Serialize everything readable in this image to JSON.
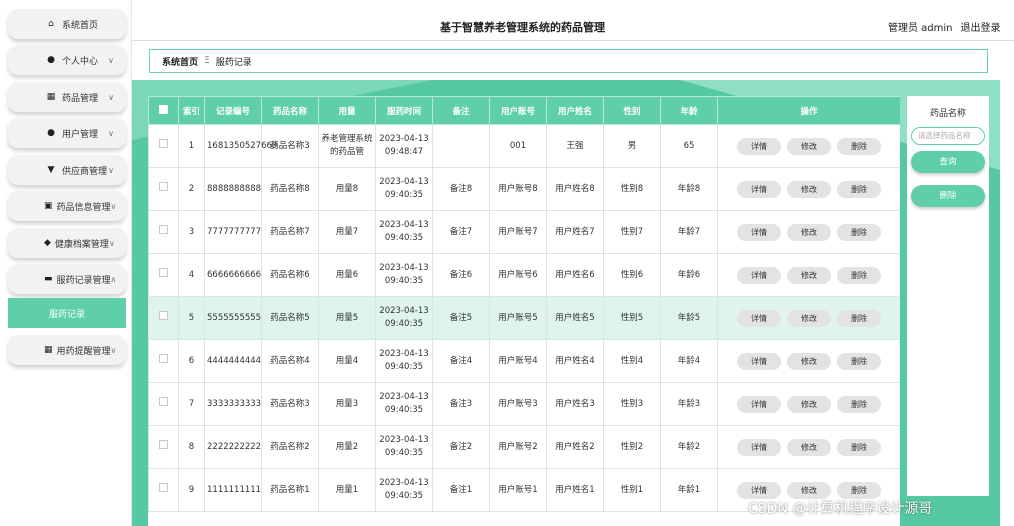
{
  "header": {
    "title": "基于智慧养老管理系统的药品管理",
    "user": "管理员 admin",
    "logout": "退出登录"
  },
  "sidebar": {
    "items": [
      {
        "label": "系统首页",
        "icon": "home-icon"
      },
      {
        "label": "个人中心",
        "icon": "user-icon"
      },
      {
        "label": "药品管理",
        "icon": "grid-icon"
      },
      {
        "label": "用户管理",
        "icon": "user-icon"
      },
      {
        "label": "供应商管理",
        "icon": "funnel-icon"
      },
      {
        "label": "药品信息管理",
        "icon": "chart-icon"
      },
      {
        "label": "健康档案管理",
        "icon": "pin-icon"
      },
      {
        "label": "服药记录管理",
        "icon": "monitor-icon"
      },
      {
        "label": "用药提醒管理",
        "icon": "grid-icon"
      }
    ],
    "sub_item": "服药记录"
  },
  "breadcrumb": {
    "home": "系统首页",
    "sep": "Ξ",
    "current": "服药记录"
  },
  "table": {
    "headers": [
      "索引",
      "记录编号",
      "药品名称",
      "用量",
      "服药时间",
      "备注",
      "用户账号",
      "用户姓名",
      "性别",
      "年龄",
      "操作"
    ],
    "actions": {
      "detail": "详情",
      "edit": "修改",
      "delete": "删除"
    },
    "rows": [
      {
        "index": "1",
        "code": "1681350527669",
        "drug": "药品名称3",
        "dose": "养老管理系统的药品管",
        "time": "2023-04-13 09:48:47",
        "note": "",
        "account": "001",
        "name": "王强",
        "gender": "男",
        "age": "65"
      },
      {
        "index": "2",
        "code": "8888888888",
        "drug": "药品名称8",
        "dose": "用量8",
        "time": "2023-04-13 09:40:35",
        "note": "备注8",
        "account": "用户账号8",
        "name": "用户姓名8",
        "gender": "性别8",
        "age": "年龄8"
      },
      {
        "index": "3",
        "code": "7777777777",
        "drug": "药品名称7",
        "dose": "用量7",
        "time": "2023-04-13 09:40:35",
        "note": "备注7",
        "account": "用户账号7",
        "name": "用户姓名7",
        "gender": "性别7",
        "age": "年龄7"
      },
      {
        "index": "4",
        "code": "6666666666",
        "drug": "药品名称6",
        "dose": "用量6",
        "time": "2023-04-13 09:40:35",
        "note": "备注6",
        "account": "用户账号6",
        "name": "用户姓名6",
        "gender": "性别6",
        "age": "年龄6"
      },
      {
        "index": "5",
        "code": "5555555555",
        "drug": "药品名称5",
        "dose": "用量5",
        "time": "2023-04-13 09:40:35",
        "note": "备注5",
        "account": "用户账号5",
        "name": "用户姓名5",
        "gender": "性别5",
        "age": "年龄5"
      },
      {
        "index": "6",
        "code": "4444444444",
        "drug": "药品名称4",
        "dose": "用量4",
        "time": "2023-04-13 09:40:35",
        "note": "备注4",
        "account": "用户账号4",
        "name": "用户姓名4",
        "gender": "性别4",
        "age": "年龄4"
      },
      {
        "index": "7",
        "code": "3333333333",
        "drug": "药品名称3",
        "dose": "用量3",
        "time": "2023-04-13 09:40:35",
        "note": "备注3",
        "account": "用户账号3",
        "name": "用户姓名3",
        "gender": "性别3",
        "age": "年龄3"
      },
      {
        "index": "8",
        "code": "2222222222",
        "drug": "药品名称2",
        "dose": "用量2",
        "time": "2023-04-13 09:40:35",
        "note": "备注2",
        "account": "用户账号2",
        "name": "用户姓名2",
        "gender": "性别2",
        "age": "年龄2"
      },
      {
        "index": "9",
        "code": "1111111111",
        "drug": "药品名称1",
        "dose": "用量1",
        "time": "2023-04-13 09:40:35",
        "note": "备注1",
        "account": "用户账号1",
        "name": "用户姓名1",
        "gender": "性别1",
        "age": "年龄1"
      }
    ]
  },
  "search": {
    "title": "药品名称",
    "placeholder": "请选择药品名称",
    "query_button": "查询",
    "delete_button": "删除"
  },
  "watermark": "CSDN @计算机程序设计源哥",
  "colors": {
    "accent": "#5fcfaa",
    "panel": "#56c9a2"
  }
}
